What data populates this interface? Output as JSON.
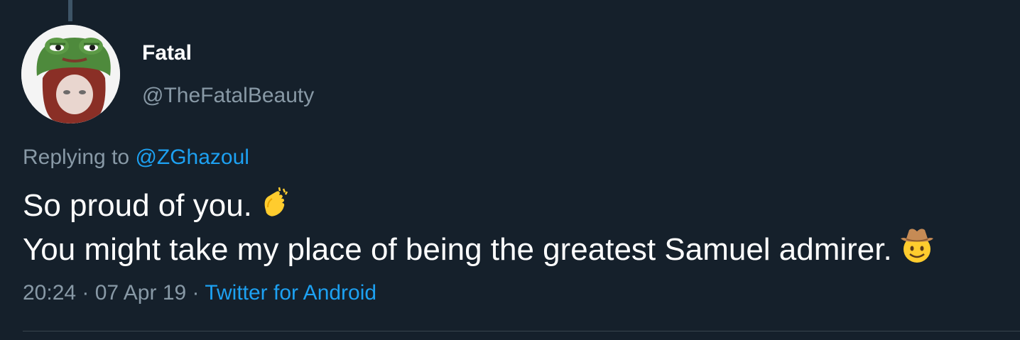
{
  "author": {
    "display_name": "Fatal",
    "handle": "@TheFatalBeauty"
  },
  "reply": {
    "prefix": "Replying to",
    "mention": "@ZGhazoul"
  },
  "tweet": {
    "line1": "So proud of you.",
    "line1_emoji": "clapping-hands-emoji",
    "line2": "You might take my place of being the greatest Samuel admirer.",
    "line2_emoji": "cowboy-hat-face-emoji"
  },
  "meta": {
    "time": "20:24",
    "sep1": " · ",
    "date": "07 Apr 19",
    "sep2": " · ",
    "source": "Twitter for Android"
  },
  "colors": {
    "background": "#15202b",
    "secondary_text": "#8899a6",
    "link": "#1da1f2",
    "primary_text": "#ffffff"
  }
}
